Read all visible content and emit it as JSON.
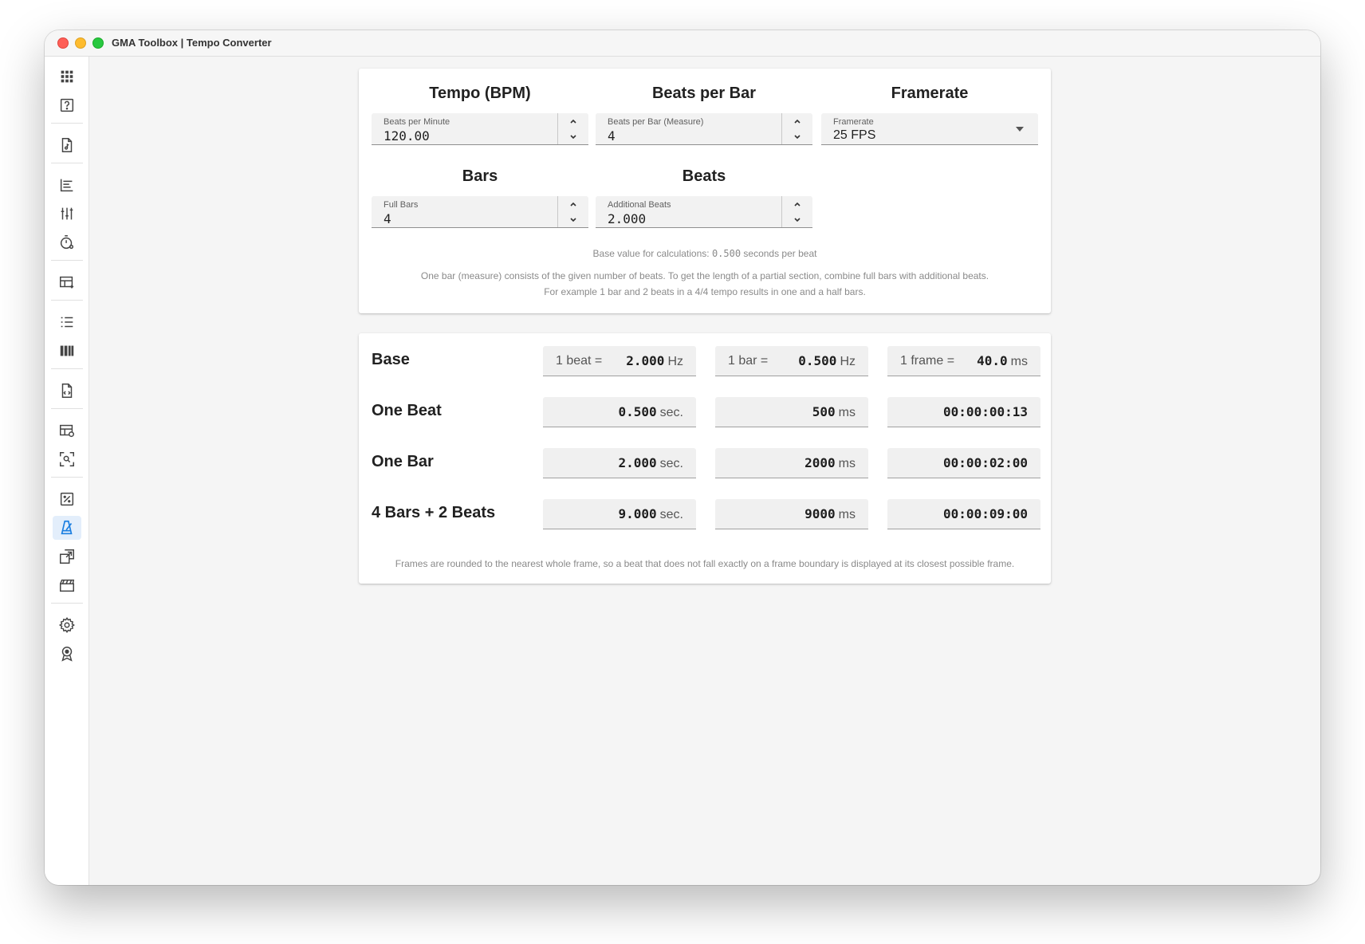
{
  "window": {
    "title": "GMA Toolbox | Tempo Converter"
  },
  "sidebar": {
    "items": [
      {
        "icon": "apps-grid-icon",
        "active": false
      },
      {
        "icon": "help-icon",
        "active": false
      },
      {
        "icon": "music-file-icon",
        "active": false
      },
      {
        "icon": "timeline-icon",
        "active": false
      },
      {
        "icon": "sliders-icon",
        "active": false
      },
      {
        "icon": "timer-icon",
        "active": false
      },
      {
        "icon": "table-export-icon",
        "active": false
      },
      {
        "icon": "list-icon",
        "active": false
      },
      {
        "icon": "columns-icon",
        "active": false
      },
      {
        "icon": "code-file-icon",
        "active": false
      },
      {
        "icon": "table-view-icon",
        "active": false
      },
      {
        "icon": "scan-search-icon",
        "active": false
      },
      {
        "icon": "percent-icon",
        "active": false
      },
      {
        "icon": "metronome-icon",
        "active": true
      },
      {
        "icon": "open-window-icon",
        "active": false
      },
      {
        "icon": "clapperboard-icon",
        "active": false
      },
      {
        "icon": "settings-gear-icon",
        "active": false
      },
      {
        "icon": "award-icon",
        "active": false
      }
    ],
    "accent": "#1a7ee0"
  },
  "inputs": {
    "tempo": {
      "title": "Tempo (BPM)",
      "label": "Beats per Minute",
      "value": "120.00"
    },
    "beats_per_bar": {
      "title": "Beats per Bar",
      "label": "Beats per Bar (Measure)",
      "value": "4"
    },
    "framerate": {
      "title": "Framerate",
      "label": "Framerate",
      "value": "25 FPS"
    },
    "bars": {
      "title": "Bars",
      "label": "Full Bars",
      "value": "4"
    },
    "beats": {
      "title": "Beats",
      "label": "Additional Beats",
      "value": "2.000"
    }
  },
  "notes": {
    "base_prefix": "Base value for calculations: ",
    "base_value": "0.500",
    "base_suffix": " seconds per beat",
    "line1": "One bar (measure) consists of the given number of beats. To get the length of a partial section, combine full bars with additional beats.",
    "line2": "For example 1 bar and 2 beats in a 4/4 tempo results in one and a half bars."
  },
  "results": {
    "base": {
      "label": "Base",
      "beat_prefix": "1 beat =",
      "beat_value": "2.000",
      "beat_unit": "Hz",
      "bar_prefix": "1 bar =",
      "bar_value": "0.500",
      "bar_unit": "Hz",
      "frame_prefix": "1 frame =",
      "frame_value": "40.0",
      "frame_unit": "ms"
    },
    "one_beat": {
      "label": "One Beat",
      "sec": "0.500",
      "sec_unit": "sec.",
      "ms": "500",
      "ms_unit": "ms",
      "tc": "00:00:00:13"
    },
    "one_bar": {
      "label": "One Bar",
      "sec": "2.000",
      "sec_unit": "sec.",
      "ms": "2000",
      "ms_unit": "ms",
      "tc": "00:00:02:00"
    },
    "combo": {
      "label": "4 Bars + 2 Beats",
      "sec": "9.000",
      "sec_unit": "sec.",
      "ms": "9000",
      "ms_unit": "ms",
      "tc": "00:00:09:00"
    },
    "footnote": "Frames are rounded to the nearest whole frame, so a beat that does not fall exactly on a frame boundary is displayed at its closest possible frame."
  }
}
